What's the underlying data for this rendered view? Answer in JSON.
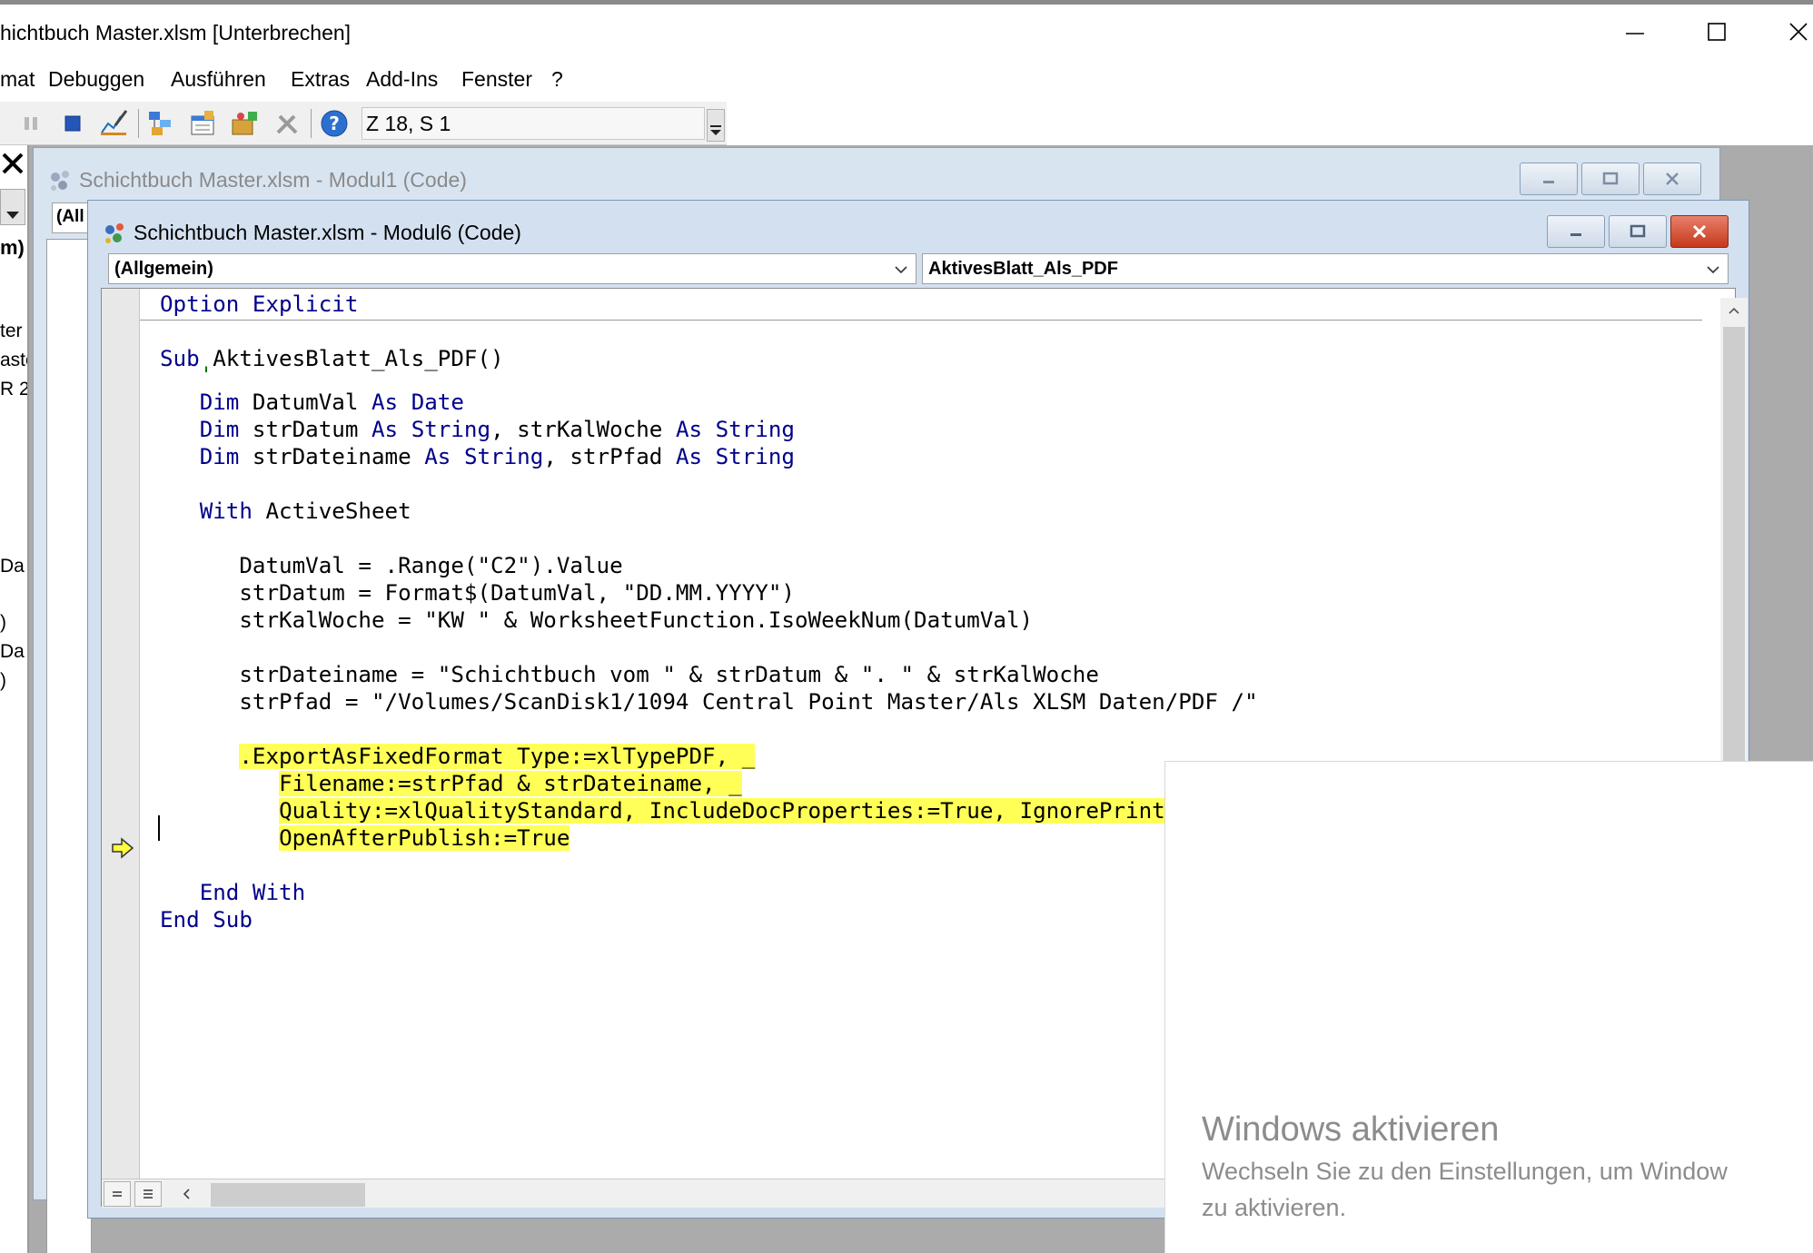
{
  "window": {
    "title": "hichtbuch Master.xlsm [Unterbrechen]"
  },
  "menu": [
    "mat",
    "Debuggen",
    "Ausführen",
    "Extras",
    "Add-Ins",
    "Fenster",
    "?"
  ],
  "toolbar": {
    "position": "Z 18, S 1"
  },
  "left_pane": {
    "fragments": [
      "m)",
      "ter",
      "aste",
      "R 2",
      "Da",
      ")",
      "Da",
      ")"
    ]
  },
  "windows": {
    "modul1": {
      "title": "Schichtbuch Master.xlsm - Modul1 (Code)",
      "combo_fragment": "(All"
    },
    "modul6": {
      "title": "Schichtbuch Master.xlsm - Modul6 (Code)",
      "object_combo": "(Allgemein)",
      "procedure_combo": "AktivesBlatt_Als_PDF"
    }
  },
  "code": {
    "l1_kw": "Option Explicit",
    "l2_kw": "Sub",
    "l2_text": " AktivesBlatt_Als_PDF()",
    "l3_comment": "'",
    "l4_dim": "Dim",
    "l4_a": " DatumVal ",
    "l4_as": "As",
    "l4_sp": " ",
    "l4_type": "Date",
    "l5_dim": "Dim",
    "l5_a": " strDatum ",
    "l5_as1": "As",
    "l5_sp1": " ",
    "l5_type1": "String",
    "l5_b": ", strKalWoche ",
    "l5_as2": "As",
    "l5_sp2": " ",
    "l5_type2": "String",
    "l6_dim": "Dim",
    "l6_a": " strDateiname ",
    "l6_as1": "As",
    "l6_sp1": " ",
    "l6_type1": "String",
    "l6_b": ", strPfad ",
    "l6_as2": "As",
    "l6_sp2": " ",
    "l6_type2": "String",
    "l7_kw": "With",
    "l7_text": " ActiveSheet",
    "l8": "DatumVal = .Range(\"C2\").Value",
    "l9": "strDatum = Format$(DatumVal, \"DD.MM.YYYY\")",
    "l10": "strKalWoche = \"KW \" & WorksheetFunction.IsoWeekNum(DatumVal)",
    "l11": "strDateiname = \"Schichtbuch vom \" & strDatum & \". \" & strKalWoche",
    "l12": "strPfad = \"/Volumes/ScanDisk1/1094 Central Point Master/Als XLSM Daten/PDF /\"",
    "l13": ".ExportAsFixedFormat Type:=xlTypePDF, _",
    "l14": "Filename:=strPfad & strDateiname, _",
    "l15": "Quality:=xlQualityStandard, IncludeDocProperties:=True, IgnorePrintAreas:=False, _",
    "l16": "OpenAfterPublish:=True",
    "l17_kw": "End With",
    "l18_kw": "End Sub"
  },
  "activation": {
    "title": "Windows aktivieren",
    "line1": "Wechseln Sie zu den Einstellungen, um Window",
    "line2": "zu aktivieren."
  },
  "colors": {
    "keyword": "#00008b",
    "comment": "#007700",
    "highlight": "#ffff57"
  }
}
